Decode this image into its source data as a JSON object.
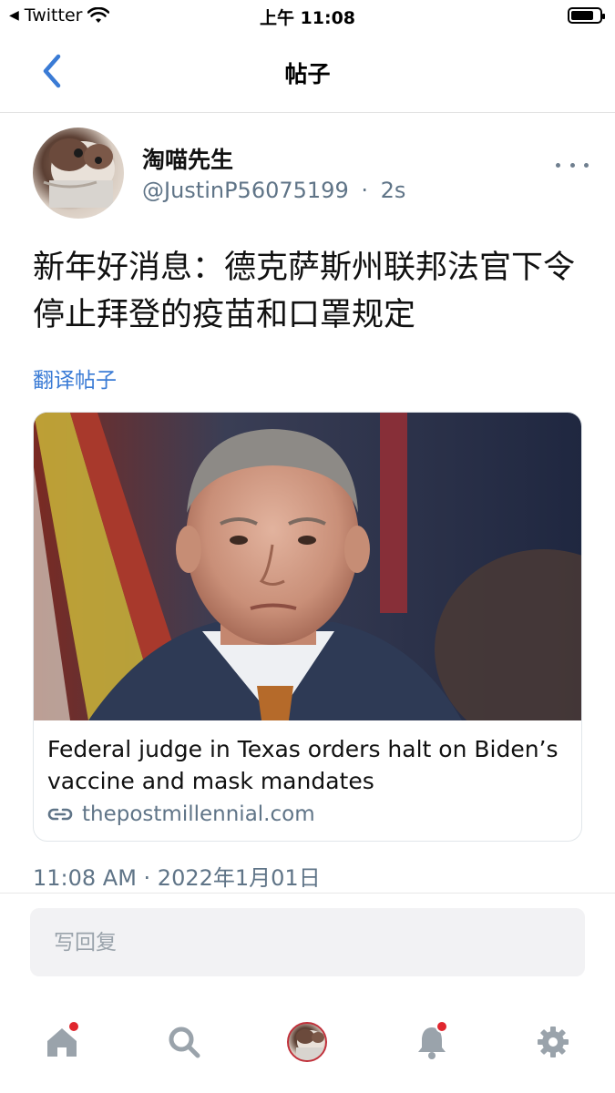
{
  "status_bar": {
    "back_app": "Twitter",
    "time": "上午 11:08"
  },
  "nav": {
    "title": "帖子"
  },
  "post": {
    "display_name": "淘喵先生",
    "handle": "@JustinP56075199",
    "separator": "·",
    "age": "2s",
    "text": "新年好消息：德克萨斯州联邦法官下令停止拜登的疫苗和口罩规定",
    "translate_label": "翻译帖子",
    "link_card": {
      "title": "Federal judge in Texas orders halt on Biden’s vaccine and mask mandates",
      "domain": "thepostmillennial.com"
    },
    "timestamp": "11:08 AM · 2022年1月01日"
  },
  "reply": {
    "placeholder": "写回复"
  },
  "tab_bar": {
    "items": [
      "home-icon",
      "search-icon",
      "profile-avatar",
      "notifications-icon",
      "settings-icon"
    ]
  },
  "colors": {
    "accent": "#3a7bd5",
    "secondary_text": "#5f7487",
    "badge": "#e0262e"
  }
}
